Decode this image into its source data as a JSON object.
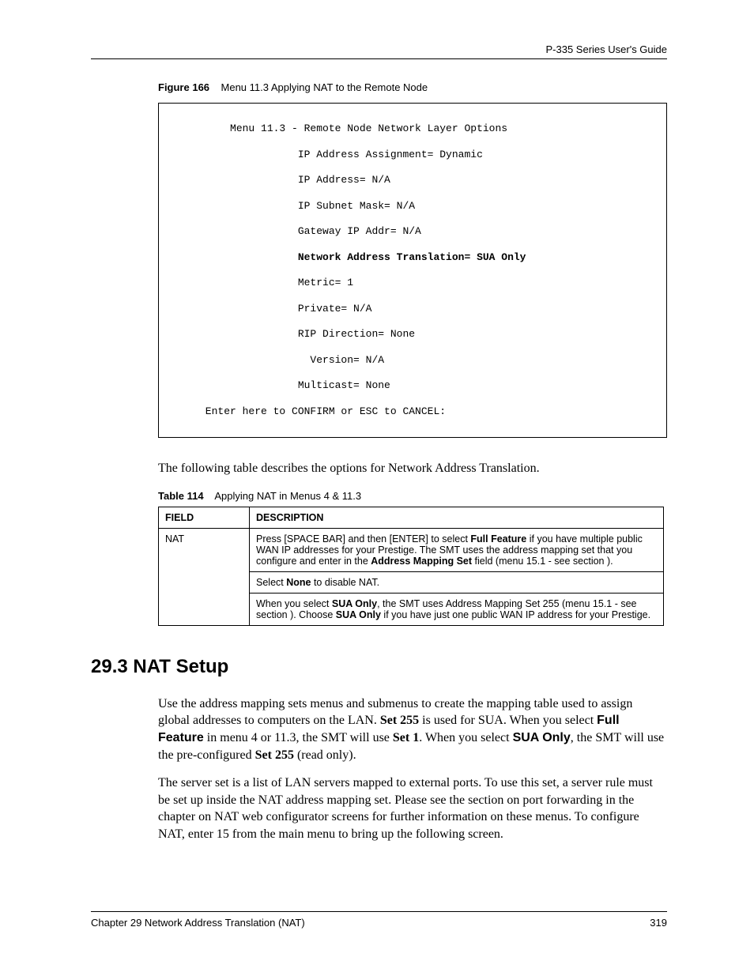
{
  "header": {
    "guide_title": "P-335 Series User's Guide"
  },
  "figure": {
    "label": "Figure 166",
    "caption": "Menu 11.3 Applying NAT to the Remote Node",
    "lines": {
      "l0": "          Menu 11.3 - Remote Node Network Layer Options",
      "l1": "                     IP Address Assignment= Dynamic",
      "l2": "                     IP Address= N/A",
      "l3": "                     IP Subnet Mask= N/A",
      "l4": "                     Gateway IP Addr= N/A",
      "l5": "                     Network Address Translation= SUA Only",
      "l6": "                     Metric= 1",
      "l7": "                     Private= N/A",
      "l8": "                     RIP Direction= None",
      "l9": "                       Version= N/A",
      "l10": "                     Multicast= None",
      "l11": "      Enter here to CONFIRM or ESC to CANCEL:"
    }
  },
  "intro_text": "The following table describes the options for Network Address Translation.",
  "table": {
    "label": "Table 114",
    "caption": "Applying NAT in Menus 4 & 11.3",
    "headers": {
      "field": "Field",
      "description": "Description"
    },
    "rows": {
      "nat_field": "NAT",
      "nat_desc1_a": "Press [SPACE BAR] and then [ENTER] to select ",
      "nat_desc1_b": "Full Feature",
      "nat_desc1_c": " if you have multiple public WAN IP addresses for your Prestige.  The SMT uses the address mapping set that you configure and enter in the ",
      "nat_desc1_d": "Address Mapping Set",
      "nat_desc1_e": " field (menu 15.1 - see section ).",
      "nat_desc2_a": "Select ",
      "nat_desc2_b": "None",
      "nat_desc2_c": " to disable NAT.",
      "nat_desc3_a": "When you select ",
      "nat_desc3_b": "SUA Only",
      "nat_desc3_c": ", the SMT uses Address Mapping Set 255 (menu 15.1 - see section ). Choose ",
      "nat_desc3_d": "SUA Only",
      "nat_desc3_e": " if you have just one public WAN IP address for your Prestige."
    }
  },
  "section": {
    "heading": "29.3  NAT Setup",
    "para1": {
      "t1": "Use the address mapping sets menus and submenus to create the mapping table used to assign global addresses to computers on the LAN. ",
      "t2": "Set 255",
      "t3": " is used for SUA. When you select ",
      "t4": "Full Feature",
      "t5": " in menu 4 or 11.3, the SMT will use ",
      "t6": "Set 1",
      "t7": ". When you select ",
      "t8": "SUA Only",
      "t9": ", the SMT will use the pre-configured ",
      "t10": "Set 255",
      "t11": " (read only)."
    },
    "para2": "The server set is a list of LAN servers mapped to external ports. To use this set, a server rule must be set up inside the NAT address mapping set. Please see the section on port forwarding in the chapter on NAT web configurator screens for further information on these menus. To configure NAT, enter 15 from the main menu to bring up the following screen."
  },
  "footer": {
    "chapter": "Chapter 29 Network Address Translation (NAT)",
    "page": "319"
  }
}
